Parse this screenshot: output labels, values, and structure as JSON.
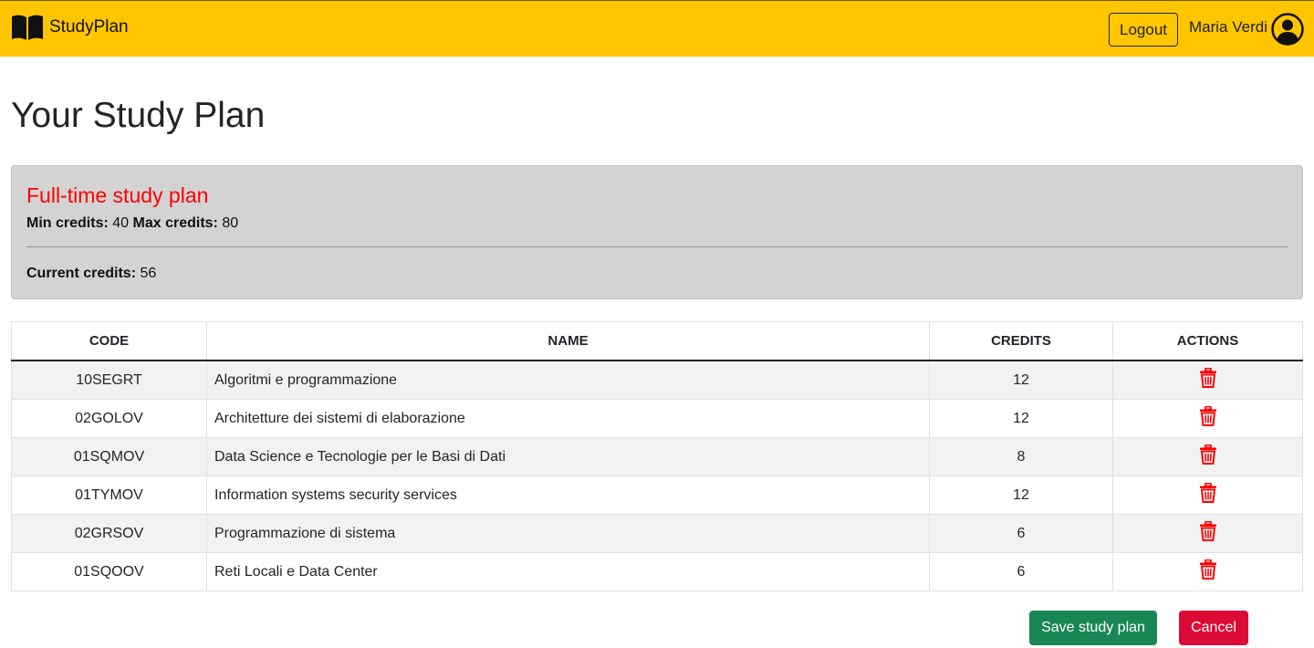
{
  "navbar": {
    "brand": "StudyPlan",
    "brand_icon": "book-icon",
    "logout_label": "Logout",
    "username": "Maria Verdi",
    "avatar_icon": "person-circle-icon",
    "background_color": "#ffc600"
  },
  "page": {
    "title": "Your Study Plan"
  },
  "summary": {
    "plan_type": "Full-time study plan",
    "min_label": "Min credits:",
    "min_value": "40",
    "max_label": "Max credits:",
    "max_value": "80",
    "current_label": "Current credits:",
    "current_value": "56",
    "plan_type_color": "#ff0000"
  },
  "table": {
    "headers": [
      "CODE",
      "NAME",
      "CREDITS",
      "ACTIONS"
    ],
    "rows": [
      {
        "code": "10SEGRT",
        "name": "Algoritmi e programmazione",
        "credits": "12"
      },
      {
        "code": "02GOLOV",
        "name": "Architetture dei sistemi di elaborazione",
        "credits": "12"
      },
      {
        "code": "01SQMOV",
        "name": "Data Science e Tecnologie per le Basi di Dati",
        "credits": "8"
      },
      {
        "code": "01TYMOV",
        "name": "Information systems security services",
        "credits": "12"
      },
      {
        "code": "02GRSOV",
        "name": "Programmazione di sistema",
        "credits": "6"
      },
      {
        "code": "01SQOOV",
        "name": "Reti Locali e Data Center",
        "credits": "6"
      }
    ],
    "action_icon": "trash-icon",
    "action_color": "#ff0000"
  },
  "actions": {
    "save_label": "Save study plan",
    "cancel_label": "Cancel",
    "save_color": "#198754",
    "cancel_color": "#dc0b35"
  }
}
